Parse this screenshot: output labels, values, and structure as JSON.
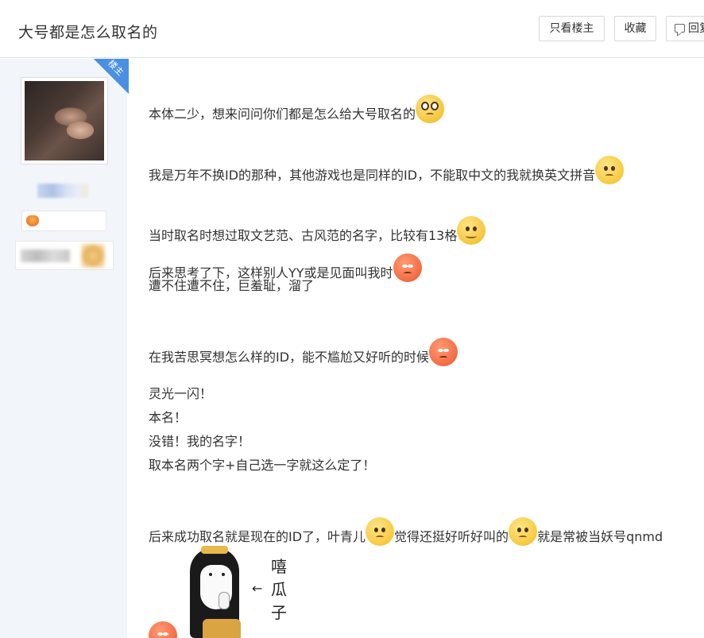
{
  "header": {
    "title": "大号都是怎么取名的",
    "only_op_label": "只看楼主",
    "favorite_label": "收藏",
    "reply_label": "回复"
  },
  "sidebar": {
    "op_badge": "楼主"
  },
  "post": {
    "lines": [
      "本体二少，想来问问你们都是怎么给大号取名的",
      "我是万年不换ID的那种，其他游戏也是同样的ID，不能取中文的我就换英文拼音",
      "当时取名时想过取文艺范、古风范的名字，比较有13格",
      "后来思考了下，这样别人YY或是见面叫我时",
      "遭不住遭不住，巨羞耻，溜了",
      "在我苦思冥想怎么样的ID，能不尴尬又好听的时候",
      "灵光一闪！",
      "本名！",
      "没错！我的名字！",
      "取本名两个字+自己选一字就这么定了！",
      "后来成功取名就是现在的ID了，叶青儿",
      "觉得还挺好听好叫的",
      "就是常被当妖号qnmd"
    ]
  },
  "sticker": {
    "text": "嘻瓜子"
  },
  "icons": {
    "emoji_1": "crying-eyes-emoji",
    "emoji_2": "sad-emoji",
    "emoji_3": "smile-emoji",
    "emoji_4": "angry-emoji",
    "emoji_5": "angry-emoji",
    "emoji_6": "sad-emoji",
    "emoji_7": "sad-emoji",
    "emoji_8": "angry-emoji"
  }
}
